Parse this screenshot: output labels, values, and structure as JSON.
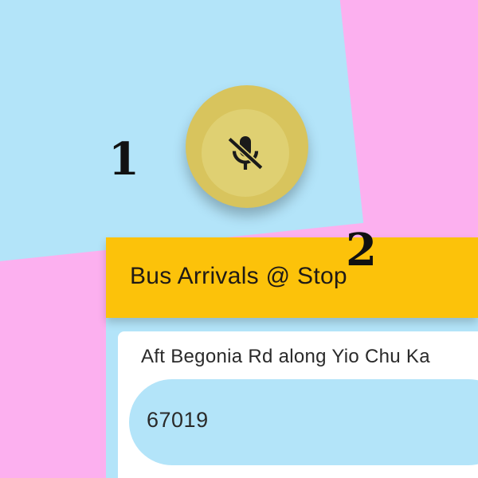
{
  "annotations": {
    "first": "1",
    "second": "2"
  },
  "mic_button": {
    "icon": "mic-off-icon",
    "state": "muted"
  },
  "header": {
    "title": "Bus Arrivals @ Stop"
  },
  "stop": {
    "name": "Aft Begonia Rd along Yio Chu Ka",
    "code": "67019"
  },
  "colors": {
    "background_pink": "#fcb0ef",
    "background_blue": "#b3e4f9",
    "header_yellow": "#fcc20a",
    "mic_button": "#d8c45d",
    "mic_button_inner": "#dfd072",
    "stop_code_pill": "#b3e4f9",
    "card": "#ffffff"
  }
}
